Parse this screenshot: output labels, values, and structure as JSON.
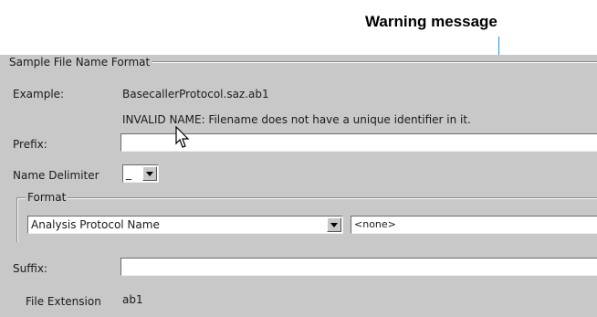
{
  "annotation": {
    "callout": "Warning message"
  },
  "group": {
    "title": "Sample File Name Format"
  },
  "example": {
    "label": "Example:",
    "value": "BasecallerProtocol.saz.ab1"
  },
  "warning": {
    "text": "INVALID NAME:  Filename does not have a unique identifier in it."
  },
  "prefix": {
    "label": "Prefix:",
    "value": ""
  },
  "delimiter": {
    "label": "Name Delimiter",
    "value": "_"
  },
  "format": {
    "title": "Format",
    "field1": {
      "value": "Analysis Protocol Name"
    },
    "field2": {
      "value": "<none>"
    }
  },
  "suffix": {
    "label": "Suffix:",
    "value": ""
  },
  "extension": {
    "label": "File Extension",
    "value": "ab1"
  },
  "colors": {
    "panel": "#c8c8c8",
    "callout_line": "#2b8fd8"
  }
}
